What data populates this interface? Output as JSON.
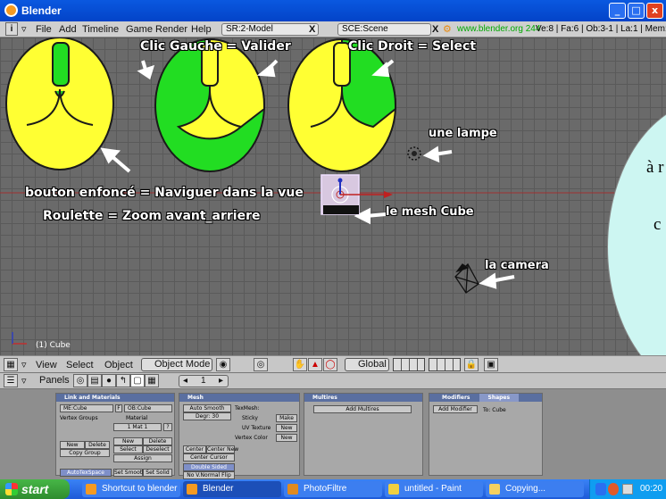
{
  "window": {
    "title": "Blender",
    "minimize_glyph": "_",
    "maximize_glyph": "□",
    "close_glyph": "x"
  },
  "menubar": {
    "info_glyph": "i",
    "items": [
      "File",
      "Add",
      "Timeline",
      "Game",
      "Render",
      "Help"
    ],
    "screen": "SR:2-Model",
    "scene": "SCE:Scene",
    "close_glyph": "X",
    "url": "www.blender.org 244",
    "stats": "Ve:8 | Fa:6 | Ob:3-1 | La:1 | Mem:"
  },
  "viewport": {
    "object_label": "(1) Cube"
  },
  "annotations": {
    "left_click": "Clic Gauche = Valider",
    "right_click": "Clic Droit  = Select",
    "middle_click": "bouton enfoncé = Naviguer dans la vue",
    "wheel": "Roulette = Zoom avant_arriere",
    "lamp": "une lampe",
    "mesh": "le mesh Cube",
    "camera": "la camera"
  },
  "callout": {
    "line1": "à r",
    "line2": "c"
  },
  "view_header": {
    "menus": [
      "View",
      "Select",
      "Object"
    ],
    "mode": "Object Mode",
    "orientation": "Global"
  },
  "panels_header": {
    "label": "Panels",
    "frame": "1",
    "prev_glyph": "◂",
    "next_glyph": "▸"
  },
  "panels": {
    "link": {
      "title": "Link and Materials",
      "me": "ME:Cube",
      "f_label": "F",
      "ob": "OB:Cube",
      "vertex_groups": "Vertex Groups",
      "material": "Material",
      "mat_slot": "1 Mat 1",
      "mat_question": "?",
      "new": "New",
      "delete": "Delete",
      "copy_group": "Copy Group",
      "mat_new": "New",
      "mat_delete": "Delete",
      "select": "Select",
      "deselect": "Deselect",
      "assign": "Assign",
      "autotexspace": "AutoTexSpace",
      "set_smooth": "Set Smooth",
      "set_solid": "Set Solid"
    },
    "mesh": {
      "title": "Mesh",
      "auto_smooth": "Auto Smooth",
      "degr": "Degr: 30",
      "texmesh": "TexMesh:",
      "sticky": "Sticky",
      "make": "Make",
      "uv_texture": "UV Texture",
      "uv_new": "New",
      "vertex_color": "Vertex Color",
      "vc_new": "New",
      "center": "Center",
      "center_new": "Center New",
      "center_cursor": "Center Cursor",
      "double_sided": "Double Sided",
      "no_vnormal_flip": "No V.Normal Flip"
    },
    "multires": {
      "title": "Multires",
      "add_multires": "Add Multires"
    },
    "modifiers": {
      "tab1": "Modifiers",
      "tab2": "Shapes",
      "add_modifier": "Add Modifier",
      "to": "To: Cube"
    }
  },
  "taskbar": {
    "start": "start",
    "items": [
      {
        "label": "Shortcut to blender",
        "color": "#f59a22"
      },
      {
        "label": "Blender",
        "color": "#f59a22"
      },
      {
        "label": "PhotoFiltre",
        "color": "#e08a20"
      },
      {
        "label": "untitled - Paint",
        "color": "#f0d040"
      },
      {
        "label": "Copying...",
        "color": "#f5d060"
      }
    ],
    "clock": "00:20"
  },
  "colors": {
    "egg_yellow": "#ffff33",
    "egg_green": "#22dd22",
    "egg_outline": "#1a1a1a",
    "arrow": "#ffffff"
  }
}
